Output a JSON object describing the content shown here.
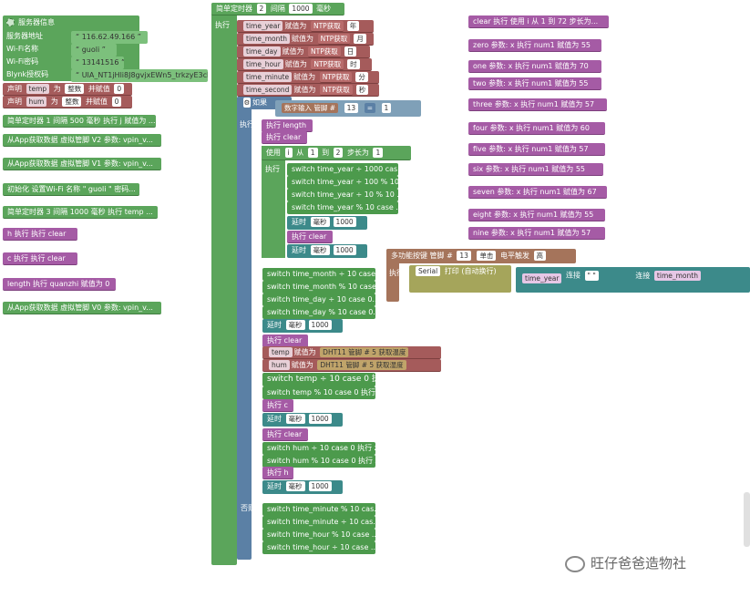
{
  "server_block": {
    "title": "服务器信息",
    "rows": [
      {
        "label": "服务器地址",
        "value": "116.62.49.166"
      },
      {
        "label": "Wi-Fi名称",
        "value": "guoli"
      },
      {
        "label": "Wi-Fi密码",
        "value": "13141516"
      },
      {
        "label": "Blynk授权码",
        "value": "UIA_NT1jHli8J8gvjxEWn5_trkzyE3ck"
      }
    ]
  },
  "declare": [
    {
      "kw": "声明",
      "name": "temp",
      "as": "为",
      "type": "整数",
      "assign": "并赋值",
      "value": "0"
    },
    {
      "kw": "声明",
      "name": "hum",
      "as": "为",
      "type": "整数",
      "assign": "并赋值",
      "value": "0"
    }
  ],
  "left_blocks": [
    "简单定时器 1 间隔 500 毫秒 执行 j 赋值为 ...",
    "从App获取数据 虚拟管脚 V2 参数: vpin_v...",
    "从App获取数据 虚拟管脚 V1 参数: vpin_v...",
    "初始化 设置Wi-Fi 名称 \" guoli \" 密码...",
    "简单定时器 3 间隔 1000 毫秒 执行 temp ...",
    "h 执行 执行 clear",
    "c 执行 执行 clear",
    "length 执行 quanzhi 赋值为 0",
    "从App获取数据 虚拟管脚 V0 参数: vpin_v..."
  ],
  "timer": {
    "kw": "简单定时器",
    "id": "2",
    "interval_kw": "间隔",
    "interval": "1000",
    "unit": "毫秒",
    "exec": "执行"
  },
  "ntp": [
    {
      "var": "time_year",
      "assign": "赋值为",
      "fn": "NTP获取",
      "field": "年"
    },
    {
      "var": "time_month",
      "assign": "赋值为",
      "fn": "NTP获取",
      "field": "月"
    },
    {
      "var": "time_day",
      "assign": "赋值为",
      "fn": "NTP获取",
      "field": "日"
    },
    {
      "var": "time_hour",
      "assign": "赋值为",
      "fn": "NTP获取",
      "field": "时"
    },
    {
      "var": "time_minute",
      "assign": "赋值为",
      "fn": "NTP获取",
      "field": "分"
    },
    {
      "var": "time_second",
      "assign": "赋值为",
      "fn": "NTP获取",
      "field": "秒"
    }
  ],
  "if_block": {
    "kw": "如果",
    "input": "数字输入 管脚 #",
    "pin": "13",
    "op": "=",
    "val": "1"
  },
  "exec_length": {
    "exec": "执行",
    "a": "length",
    "b": "clear"
  },
  "for_loop": {
    "use": "使用",
    "var": "i",
    "from": "从",
    "start": "1",
    "to": "到",
    "end": "2",
    "step_kw": "步长为",
    "step": "1"
  },
  "switch_year": [
    "switch time_year ÷ 1000 cas...",
    "switch time_year ÷ 100 % 10...",
    "switch time_year ÷ 10 % 10 ...",
    "switch time_year % 10 case ..."
  ],
  "delay": {
    "kw": "延时",
    "unit": "毫秒",
    "value": "1000"
  },
  "clear_kw": "执行",
  "clear_val": "clear",
  "multi_btn": {
    "kw": "多功能按键 管脚 #",
    "pin": "13",
    "mode": "单击",
    "trigger": "电平触发",
    "level": "高"
  },
  "serial": {
    "exec": "执行",
    "port": "Serial",
    "print": "打印 (自动换行)",
    "v1": "time_year",
    "join": "连接",
    "sep": "\" \"",
    "v2": "time_month"
  },
  "switch_month": [
    "switch time_month ÷ 10 case...",
    "switch time_month % 10 case ...",
    "switch time_day ÷ 10 case 0...",
    "switch time_day % 10 case 0..."
  ],
  "dht": [
    {
      "var": "temp",
      "assign": "赋值为",
      "sensor": "DHT11",
      "pin_kw": "管脚 #",
      "pin": "5",
      "read": "获取温度"
    },
    {
      "var": "hum",
      "assign": "赋值为",
      "sensor": "DHT11",
      "pin_kw": "管脚 #",
      "pin": "5",
      "read": "获取湿度"
    }
  ],
  "switch_temp": [
    "switch temp ÷ 10 case 0 执行 ...",
    "switch temp % 10 case 0 执行 ..."
  ],
  "exec_c": "c",
  "switch_hum": [
    "switch hum ÷ 10 case 0 执行 z...",
    "switch hum % 10 case 0 执行 z..."
  ],
  "exec_h": "h",
  "else_kw": "否则",
  "switch_minute": [
    "switch time_minute % 10 cas...",
    "switch time_minute ÷ 10 cas...",
    "switch time_hour % 10 case ...",
    "switch time_hour ÷ 10 case ..."
  ],
  "right_blocks": [
    "clear 执行 使用 i 从 1 到 72 步长为...",
    "zero 参数: x 执行 num1 赋值为 55",
    "one 参数: x 执行 num1 赋值为 70",
    "two 参数: x 执行 num1 赋值为 55",
    "three 参数: x 执行 num1 赋值为 57",
    "four 参数: x 执行 num1 赋值为 60",
    "five 参数: x 执行 num1 赋值为 57",
    "six 参数: x 执行 num1 赋值为 55",
    "seven 参数: x 执行 num1 赋值为 67",
    "eight 参数: x 执行 num1 赋值为 55",
    "nine 参数: x 执行 num1 赋值为 57"
  ],
  "watermark": "旺仔爸爸造物社"
}
